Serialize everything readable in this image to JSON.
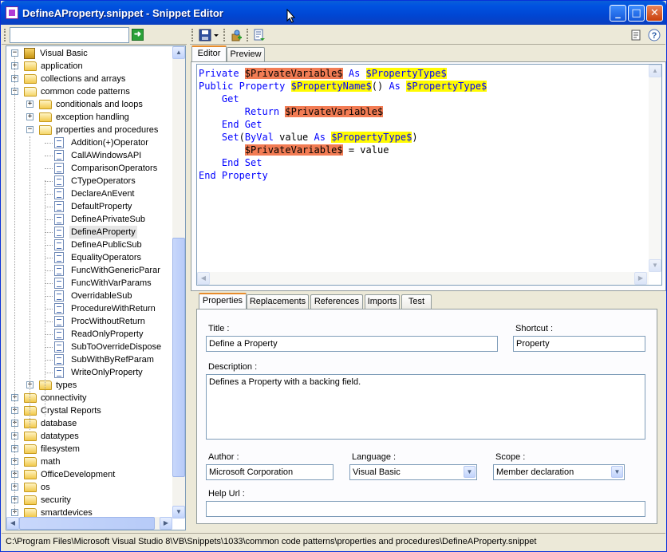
{
  "window": {
    "title": "DefineAProperty.snippet - Snippet Editor",
    "buttons": {
      "minimize": "_",
      "maximize": "□",
      "close": "✕"
    }
  },
  "search": {
    "value": "",
    "go_label": "➜"
  },
  "toolbar": {
    "save_icon": "save-icon",
    "dropdown_icon": "dropdown-arrow-icon",
    "add_icon": "add-snippet-icon",
    "export_icon": "export-icon",
    "properties_icon": "properties-page-icon",
    "help_icon": "help-icon"
  },
  "tree": {
    "root": "Visual Basic",
    "items": [
      {
        "label": "application",
        "level": 1,
        "type": "folder",
        "expander": "+"
      },
      {
        "label": "collections and arrays",
        "level": 1,
        "type": "folder",
        "expander": "+"
      },
      {
        "label": "common code patterns",
        "level": 1,
        "type": "folder",
        "expander": "−"
      },
      {
        "label": "conditionals and loops",
        "level": 2,
        "type": "folder",
        "expander": "+"
      },
      {
        "label": "exception handling",
        "level": 2,
        "type": "folder",
        "expander": "+"
      },
      {
        "label": "properties and procedures",
        "level": 2,
        "type": "folder-open",
        "expander": "−"
      },
      {
        "label": "Addition(+)Operator",
        "level": 3,
        "type": "doc"
      },
      {
        "label": "CallAWindowsAPI",
        "level": 3,
        "type": "doc"
      },
      {
        "label": "ComparisonOperators",
        "level": 3,
        "type": "doc"
      },
      {
        "label": "CTypeOperators",
        "level": 3,
        "type": "doc"
      },
      {
        "label": "DeclareAnEvent",
        "level": 3,
        "type": "doc"
      },
      {
        "label": "DefaultProperty",
        "level": 3,
        "type": "doc"
      },
      {
        "label": "DefineAPrivateSub",
        "level": 3,
        "type": "doc"
      },
      {
        "label": "DefineAProperty",
        "level": 3,
        "type": "doc",
        "selected": true
      },
      {
        "label": "DefineAPublicSub",
        "level": 3,
        "type": "doc"
      },
      {
        "label": "EqualityOperators",
        "level": 3,
        "type": "doc"
      },
      {
        "label": "FuncWithGenericParar",
        "level": 3,
        "type": "doc"
      },
      {
        "label": "FuncWithVarParams",
        "level": 3,
        "type": "doc"
      },
      {
        "label": "OverridableSub",
        "level": 3,
        "type": "doc"
      },
      {
        "label": "ProcedureWithReturn",
        "level": 3,
        "type": "doc"
      },
      {
        "label": "ProcWithoutReturn",
        "level": 3,
        "type": "doc"
      },
      {
        "label": "ReadOnlyProperty",
        "level": 3,
        "type": "doc"
      },
      {
        "label": "SubToOverrideDispose",
        "level": 3,
        "type": "doc"
      },
      {
        "label": "SubWithByRefParam",
        "level": 3,
        "type": "doc"
      },
      {
        "label": "WriteOnlyProperty",
        "level": 3,
        "type": "doc"
      },
      {
        "label": "types",
        "level": 2,
        "type": "folder",
        "expander": "+"
      },
      {
        "label": "connectivity",
        "level": 1,
        "type": "folder",
        "expander": "+"
      },
      {
        "label": "Crystal Reports",
        "level": 1,
        "type": "folder",
        "expander": "+"
      },
      {
        "label": "database",
        "level": 1,
        "type": "folder",
        "expander": "+"
      },
      {
        "label": "datatypes",
        "level": 1,
        "type": "folder",
        "expander": "+"
      },
      {
        "label": "filesystem",
        "level": 1,
        "type": "folder",
        "expander": "+"
      },
      {
        "label": "math",
        "level": 1,
        "type": "folder",
        "expander": "+"
      },
      {
        "label": "OfficeDevelopment",
        "level": 1,
        "type": "folder",
        "expander": "+"
      },
      {
        "label": "os",
        "level": 1,
        "type": "folder",
        "expander": "+"
      },
      {
        "label": "security",
        "level": 1,
        "type": "folder",
        "expander": "+"
      },
      {
        "label": "smartdevices",
        "level": 1,
        "type": "folder",
        "expander": "+"
      }
    ]
  },
  "editor_tabs": [
    "Editor",
    "Preview"
  ],
  "code_lines": [
    [
      {
        "t": "Private ",
        "c": "kw"
      },
      {
        "t": "$PrivateVariable$",
        "c": "phv"
      },
      {
        "t": " As ",
        "c": "kw"
      },
      {
        "t": "$PropertyType$",
        "c": "ph"
      }
    ],
    [
      {
        "t": "Public Property ",
        "c": "kw"
      },
      {
        "t": "$PropertyName$",
        "c": "ph"
      },
      {
        "t": "() ",
        "c": "id"
      },
      {
        "t": "As ",
        "c": "kw"
      },
      {
        "t": "$PropertyType$",
        "c": "ph"
      }
    ],
    [
      {
        "t": "    Get",
        "c": "kw"
      }
    ],
    [
      {
        "t": "        Return ",
        "c": "kw"
      },
      {
        "t": "$PrivateVariable$",
        "c": "phv"
      }
    ],
    [
      {
        "t": "    End Get",
        "c": "kw"
      }
    ],
    [
      {
        "t": "    Set",
        "c": "kw"
      },
      {
        "t": "(",
        "c": "id"
      },
      {
        "t": "ByVal",
        "c": "kw"
      },
      {
        "t": " value ",
        "c": "id"
      },
      {
        "t": "As ",
        "c": "kw"
      },
      {
        "t": "$PropertyType$",
        "c": "ph"
      },
      {
        "t": ")",
        "c": "id"
      }
    ],
    [
      {
        "t": "        ",
        "c": "id"
      },
      {
        "t": "$PrivateVariable$",
        "c": "phv"
      },
      {
        "t": " = value",
        "c": "id"
      }
    ],
    [
      {
        "t": "    End Set",
        "c": "kw"
      }
    ],
    [
      {
        "t": "End Property",
        "c": "kw"
      }
    ]
  ],
  "props_tabs": [
    "Properties",
    "Replacements",
    "References",
    "Imports",
    "Test"
  ],
  "form": {
    "title_label": "Title :",
    "title_value": "Define a Property",
    "shortcut_label": "Shortcut :",
    "shortcut_value": "Property",
    "description_label": "Description :",
    "description_value": "Defines a Property with a backing field.",
    "author_label": "Author :",
    "author_value": "Microsoft Corporation",
    "language_label": "Language :",
    "language_value": "Visual Basic",
    "scope_label": "Scope :",
    "scope_value": "Member declaration",
    "helpurl_label": "Help Url :",
    "helpurl_value": ""
  },
  "status": {
    "path": "C:\\Program Files\\Microsoft Visual Studio 8\\VB\\Snippets\\1033\\common code patterns\\properties and procedures\\DefineAProperty.snippet"
  },
  "colors": {
    "titlebar": "#0053e1",
    "placeholder_yellow": "#fffb00",
    "placeholder_orange": "#f27c54",
    "keyword_blue": "#0000ff"
  }
}
